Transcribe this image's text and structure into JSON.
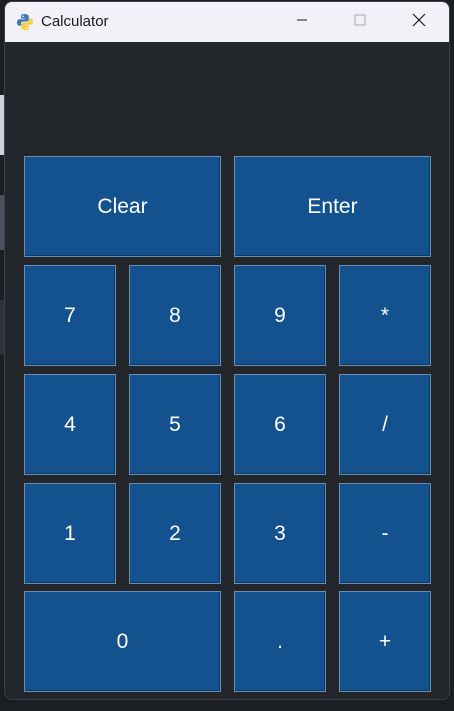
{
  "window": {
    "title": "Calculator"
  },
  "display": {
    "value": ""
  },
  "keys": {
    "clear": "Clear",
    "enter": "Enter",
    "seven": "7",
    "eight": "8",
    "nine": "9",
    "multiply": "*",
    "four": "4",
    "five": "5",
    "six": "6",
    "divide": "/",
    "one": "1",
    "two": "2",
    "three": "3",
    "subtract": "-",
    "zero": "0",
    "decimal": ".",
    "add": "+"
  },
  "icons": {
    "app": "python-icon",
    "minimize": "minimize-icon",
    "maximize": "maximize-icon",
    "close": "close-icon"
  },
  "colors": {
    "key_background": "#13528f",
    "key_border": "#6d8db0",
    "window_background": "#23272b",
    "titlebar_background": "#f3f1f8"
  }
}
